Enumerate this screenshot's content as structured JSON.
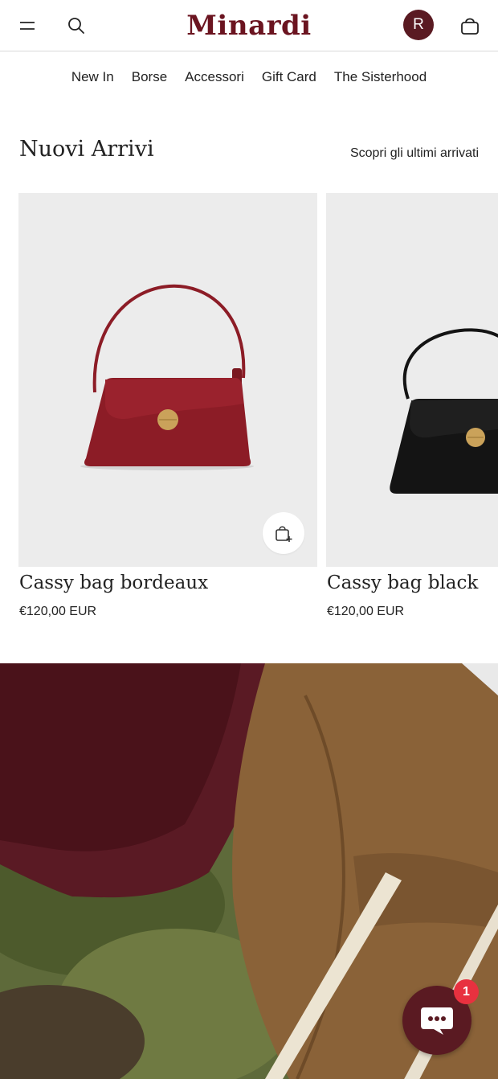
{
  "header": {
    "logo": "Minardi",
    "avatar_initial": "R",
    "brand_color": "#6b1420",
    "icons": {
      "menu": "hamburger-icon",
      "search": "search-icon",
      "cart": "shopping-bag-icon"
    }
  },
  "nav": {
    "items": [
      {
        "label": "New In"
      },
      {
        "label": "Borse"
      },
      {
        "label": "Accessori"
      },
      {
        "label": "Gift Card"
      },
      {
        "label": "The Sisterhood"
      }
    ]
  },
  "section": {
    "title": "Nuovi Arrivi",
    "link": "Scopri gli ultimi arrivati"
  },
  "products": [
    {
      "name": "Cassy bag bordeaux",
      "price": "€120,00 EUR",
      "color": "#8c1c26"
    },
    {
      "name": "Cassy bag black",
      "price": "€120,00 EUR",
      "color": "#141414"
    }
  ],
  "chat": {
    "badge_count": "1",
    "icon": "chat-bubble-icon"
  }
}
